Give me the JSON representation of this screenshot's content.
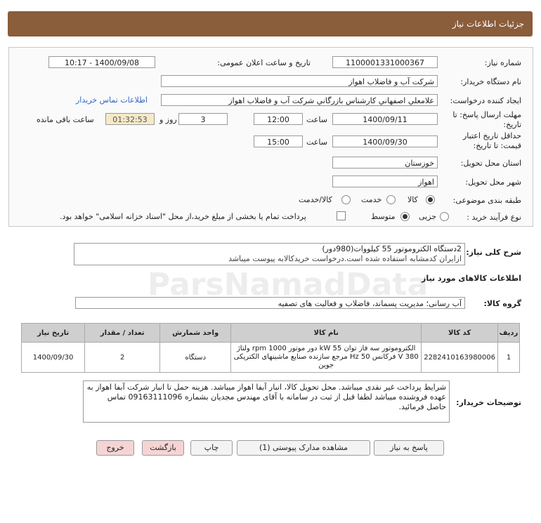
{
  "header": {
    "title": "جزئیات اطلاعات نیاز"
  },
  "form": {
    "need_number_label": "شماره نیاز:",
    "need_number": "1100001331000367",
    "announce_label": "تاریخ و ساعت اعلان عمومی:",
    "announce_value": "1400/09/08 - 10:17",
    "buyer_label": "نام دستگاه خریدار:",
    "buyer_value": "شرکت آب و فاضلاب اهواز",
    "requester_label": "ایجاد کننده درخواست:",
    "requester_value": "علامعلي اصفهاني كارشناس بازرگاني شركت آب و فاضلاب اهواز",
    "contact_link": "اطلاعات تماس خریدار",
    "deadline_label_1": "مهلت ارسال پاسخ: تا",
    "deadline_label_2": "تاریخ:",
    "deadline_date": "1400/09/11",
    "deadline_time_label": "ساعت",
    "deadline_time": "12:00",
    "days_value": "3",
    "days_label": "روز و",
    "remaining_time": "01:32:53",
    "remaining_label": "ساعت باقی مانده",
    "validity_label_1": "حداقل تاریخ اعتبار",
    "validity_label_2": "قیمت: تا تاریخ:",
    "validity_date": "1400/09/30",
    "validity_time_label": "ساعت",
    "validity_time": "15:00",
    "province_label": "استان محل تحویل:",
    "province_value": "خوزستان",
    "city_label": "شهر محل تحویل:",
    "city_value": "اهواز",
    "category_label": "طبقه بندی موضوعی:",
    "category_options": [
      "کالا",
      "خدمت",
      "کالا/خدمت"
    ],
    "purchase_label": "نوع فرآیند خرید :",
    "purchase_options": [
      "جزیی",
      "متوسط"
    ],
    "payment_note": "پرداخت تمام یا بخشی از مبلغ خرید،از محل \"اسناد خزانه اسلامی\" خواهد بود."
  },
  "summary": {
    "label": "شرح کلی نیاز:",
    "line1": "2دستگاه الکتروموتور 55 کیلووات(980دور)",
    "line2": "ازایران کدمشابه استفاده شده است.درخواست خریدکالابه پیوست میباشد"
  },
  "goods": {
    "section_title": "اطلاعات کالاهای مورد نیاز",
    "group_label": "گروه کالا:",
    "group_value": "آب رسانی؛ مدیریت پسماند، فاضلاب و فعالیت های تصفیه",
    "columns": [
      "ردیف",
      "کد کالا",
      "نام کالا",
      "واحد شمارش",
      "تعداد / مقدار",
      "تاریخ نیاز"
    ],
    "rows": [
      {
        "index": "1",
        "code": "2282410163980006",
        "name": "الکتروموتور سه فاز توان kW 55 دور موتور rpm 1000 ولتاژ 380 V فرکانس Hz 50 مرجع سازنده صنایع ماشینهای الکتریکی جوین",
        "unit": "دستگاه",
        "qty": "2",
        "date": "1400/09/30"
      }
    ]
  },
  "buyer_notes": {
    "label": "توضیحات خریدار:",
    "text": "شرایط پرداخت غیر نقدی میباشد. محل تحویل کالا، انبار آبفا اهواز میباشد. هزینه حمل تا انبار شرکت آبفا اهواز به عهده فروشنده میباشد لطفا قبل از ثبت در سامانه با آقای مهندس مجدیان بشماره 09163111096 تماس حاصل فرمائید."
  },
  "buttons": {
    "reply": "پاسخ به نیاز",
    "attachments": "مشاهده مدارک پیوستی (1)",
    "print": "چاپ",
    "back": "بازگشت",
    "exit": "خروج"
  }
}
